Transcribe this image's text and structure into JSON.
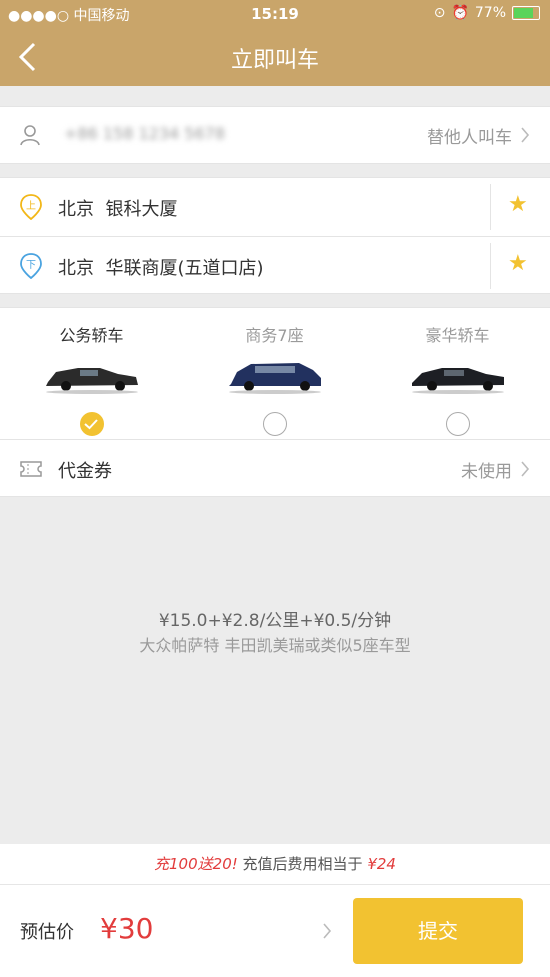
{
  "status_bar": {
    "carrier": "●●●●○ 中国移动",
    "time": "15:19",
    "battery_percent": "77%",
    "battery_level": 0.77
  },
  "header": {
    "title": "立即叫车"
  },
  "passenger": {
    "phone_masked": "+86 158 1234 5678",
    "proxy_label": "替他人叫车"
  },
  "route": {
    "start": {
      "icon_label": "上",
      "city": "北京",
      "place": "银科大厦"
    },
    "end": {
      "icon_label": "下",
      "city": "北京",
      "place": "华联商厦(五道口店)"
    }
  },
  "car_types": [
    {
      "label": "公务轿车",
      "selected": true
    },
    {
      "label": "商务7座",
      "selected": false
    },
    {
      "label": "豪华轿车",
      "selected": false
    }
  ],
  "voucher": {
    "label": "代金券",
    "status": "未使用"
  },
  "pricing": {
    "rate": "¥15.0+¥2.8/公里+¥0.5/分钟",
    "models": "大众帕萨特 丰田凯美瑞或类似5座车型"
  },
  "promo": {
    "highlight": "充100送20!",
    "text": "充值后费用相当于",
    "price": "¥24"
  },
  "footer": {
    "estimate_label": "预估价",
    "estimate_price": "¥30",
    "submit_label": "提交"
  },
  "colors": {
    "brand": "#c9a56a",
    "accent_yellow": "#f2c231",
    "price_red": "#e23c3c"
  }
}
